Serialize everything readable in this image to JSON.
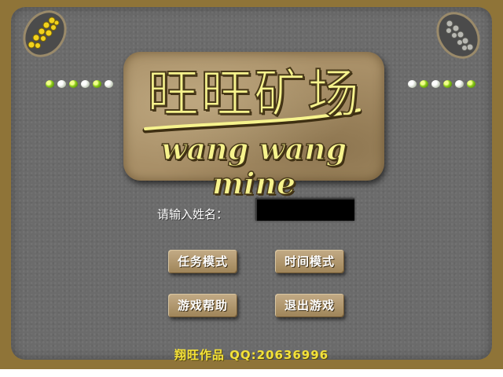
{
  "logo": {
    "title_cn": "旺旺矿场",
    "title_en": "wang wang mine"
  },
  "form": {
    "name_label": "请输入姓名：",
    "name_value": ""
  },
  "menu": {
    "task_mode": "任务模式",
    "time_mode": "时间模式",
    "help": "游戏帮助",
    "quit": "退出游戏"
  },
  "footer": {
    "credit": "翔旺作品  QQ:20636996"
  },
  "icons": {
    "corner_left": "gold-nuggets-icon",
    "corner_right": "silver-ore-icon",
    "dots": "green-pearl-icon"
  },
  "colors": {
    "frame": "#8f7438",
    "panel": "#6b6b6b",
    "logo_text": "#f6f38d",
    "footer_text": "#f3e23a"
  }
}
